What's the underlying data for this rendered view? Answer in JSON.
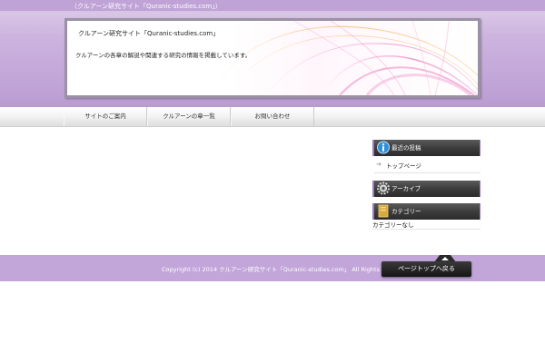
{
  "header": {
    "tagline": "（クルアーン研究サイト「Quranic-studies.com」）",
    "title": "クルアーン研究サイト「Quranic-studies.com」",
    "description": "クルアーンの各章の解説や関連する研究の情報を掲載しています。"
  },
  "nav": {
    "items": [
      {
        "label": "サイトのご案内"
      },
      {
        "label": "クルアーンの章一覧"
      },
      {
        "label": "お問い合わせ"
      }
    ]
  },
  "sidebar": {
    "recent": {
      "title": "最近の投稿",
      "icon": "info-icon",
      "items": [
        {
          "label": "トップページ"
        }
      ]
    },
    "archive": {
      "title": "アーカイブ",
      "icon": "gear-icon"
    },
    "categories": {
      "title": "カテゴリー",
      "icon": "folder-icon",
      "items": [
        {
          "label": "カテゴリーなし"
        }
      ]
    }
  },
  "footer": {
    "copyright": "Copyright (c) 2014 クルアーン研究サイト「Quranic-studies.com」 All Rights Reserved.",
    "page_top_label": "ページトップへ戻る"
  },
  "colors": {
    "header_band": "#c6acd9",
    "footer_band": "#c2a6da",
    "widget_head": "#3c3c3c",
    "accent": "#9a7bc0"
  }
}
